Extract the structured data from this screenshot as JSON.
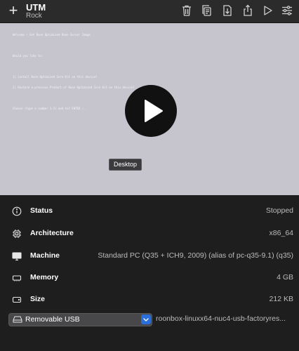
{
  "toolbar": {
    "add_icon": "plus-icon",
    "title": "UTM",
    "subtitle": "Rock",
    "icons": [
      "trash-icon",
      "clone-icon",
      "download-icon",
      "share-icon",
      "play-icon",
      "settings-sliders-icon"
    ]
  },
  "preview": {
    "console_lines": [
      "Welcome ! Set Rock Optimized Roon Server Image",
      "",
      "Would you like to:",
      "",
      "1) install Roon Optimized Core Kit on this device?",
      "2) Restore a previous Product of Roon Optimized Core Kit on this device?",
      "",
      "Choose (type a number 1-2) and hit ENTER : _"
    ],
    "tooltip": "Desktop"
  },
  "details": {
    "status": {
      "label": "Status",
      "value": "Stopped"
    },
    "architecture": {
      "label": "Architecture",
      "value": "x86_64"
    },
    "machine": {
      "label": "Machine",
      "value": "Standard PC (Q35 + ICH9, 2009) (alias of pc-q35-9.1) (q35)"
    },
    "memory": {
      "label": "Memory",
      "value": "4 GB"
    },
    "size": {
      "label": "Size",
      "value": "212 KB"
    },
    "drive": {
      "type": "Removable USB",
      "file": "roonbox-linuxx64-nuc4-usb-factoryres..."
    }
  },
  "colors": {
    "accent": "#2a6fd9",
    "background": "#1e1e1f",
    "toolbar": "#2b2b2c",
    "screen": "#c6c4cd"
  }
}
